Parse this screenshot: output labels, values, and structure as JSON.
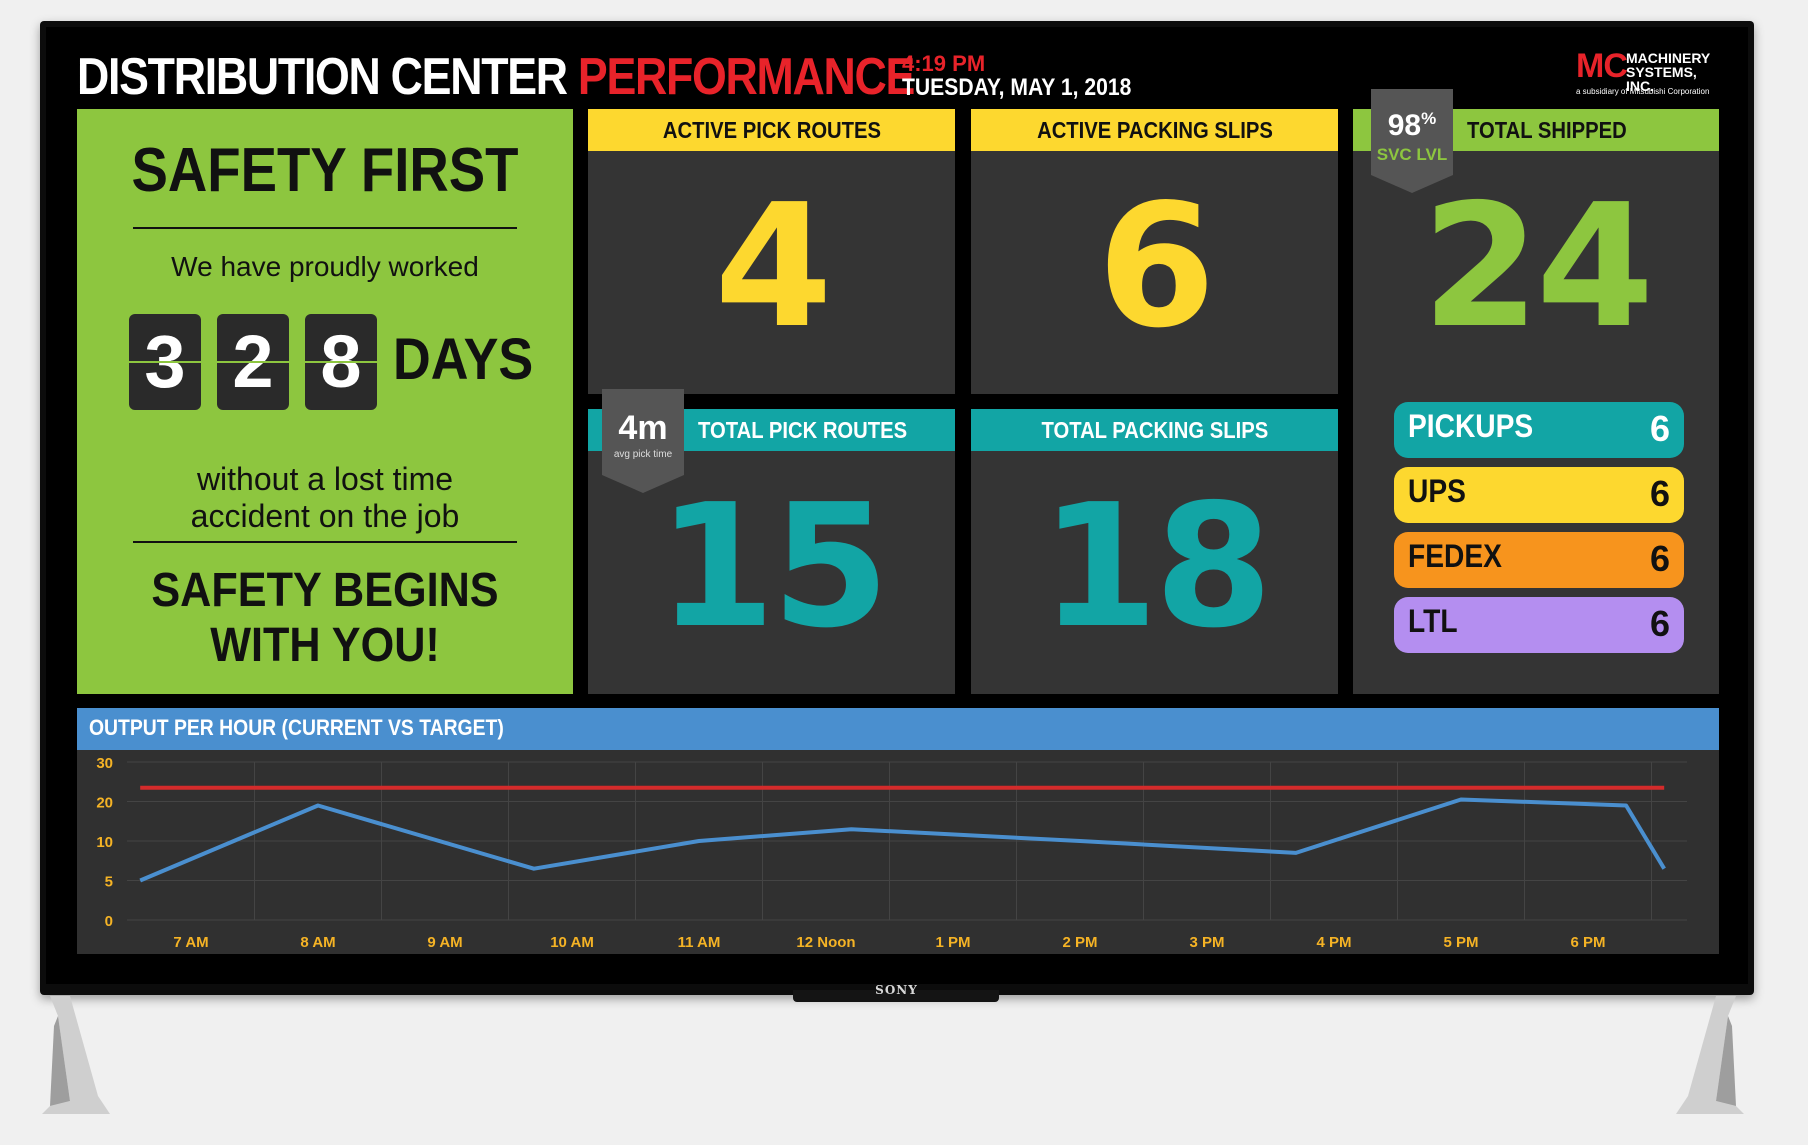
{
  "header": {
    "title_a": "DISTRIBUTION CENTER",
    "title_b": "PERFORMANCE",
    "time": "4:19 PM",
    "date": "TUESDAY, MAY 1, 2018"
  },
  "logo": {
    "mark": "MC",
    "name_line1": "MACHINERY",
    "name_line2": "SYSTEMS, INC.",
    "subtitle": "a subsidiary of Mitsubishi Corporation"
  },
  "safety": {
    "heading": "SAFETY FIRST",
    "line1": "We have proudly worked",
    "digits": [
      "3",
      "2",
      "8"
    ],
    "days_label": "DAYS",
    "line2a": "without a lost time",
    "line2b": "accident on the job",
    "footer1": "SAFETY BEGINS",
    "footer2": "WITH YOU!"
  },
  "panels": {
    "active_pick_routes": {
      "label": "ACTIVE PICK ROUTES",
      "value": "4"
    },
    "active_packing_slips": {
      "label": "ACTIVE PACKING SLIPS",
      "value": "6"
    },
    "total_shipped": {
      "label": "TOTAL SHIPPED",
      "value": "24",
      "badge_value": "98",
      "badge_unit": "%",
      "badge_label": "SVC LVL"
    },
    "total_pick_routes": {
      "label": "TOTAL PICK ROUTES",
      "value": "15",
      "badge_value": "4m",
      "badge_label": "avg pick time"
    },
    "total_packing_slips": {
      "label": "TOTAL PACKING SLIPS",
      "value": "18"
    }
  },
  "carriers": [
    {
      "name": "PICKUPS",
      "value": "6",
      "color": "#12a5a5"
    },
    {
      "name": "UPS",
      "value": "6",
      "color": "#fdd82f"
    },
    {
      "name": "FEDEX",
      "value": "6",
      "color": "#f7941d"
    },
    {
      "name": "LTL",
      "value": "6",
      "color": "#b48ef0"
    }
  ],
  "colors": {
    "yellow": "#fdd82f",
    "teal": "#12a5a5",
    "green": "#8dc63f",
    "red": "#e8232a",
    "blue": "#4a8fcf",
    "axis_label": "#f5b325"
  },
  "chart_title": "OUTPUT PER HOUR (CURRENT VS TARGET)",
  "tv_brand": "SONY",
  "chart_data": {
    "type": "line",
    "title": "OUTPUT PER HOUR (CURRENT VS TARGET)",
    "categories": [
      "7 AM",
      "8 AM",
      "9 AM",
      "10 AM",
      "11 AM",
      "12 Noon",
      "1 PM",
      "2 PM",
      "3 PM",
      "4 PM",
      "5 PM",
      "6 PM"
    ],
    "y_tick_labels": [
      "0",
      "5",
      "10",
      "20",
      "30"
    ],
    "ylim": [
      0,
      30
    ],
    "grid": true,
    "series": [
      {
        "key": "current",
        "color": "#4a8fcf",
        "x": [
          6.6,
          8,
          9.7,
          11,
          12.2,
          14,
          15.7,
          17,
          18.3,
          18.6
        ],
        "y": [
          5,
          19,
          6.5,
          10,
          13,
          10,
          8.5,
          20.5,
          19,
          6.5
        ]
      },
      {
        "key": "target",
        "color": "#d42b2b",
        "x": [
          6.6,
          18.6
        ],
        "y": [
          23.5,
          23.5
        ]
      }
    ]
  }
}
